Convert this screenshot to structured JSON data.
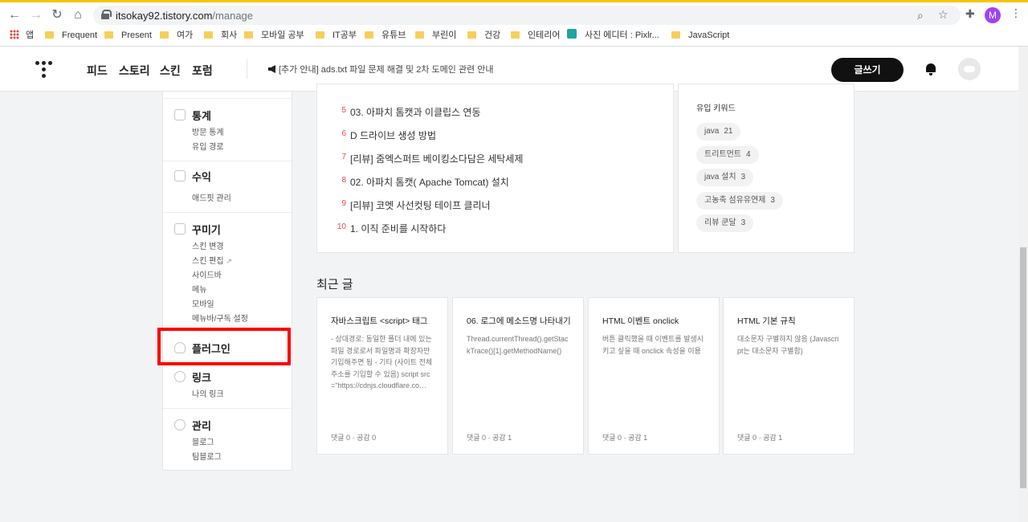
{
  "browser": {
    "url_host": "itsokay92.tistory.com",
    "url_path": "/manage",
    "profile_initial": "M",
    "bookmarks": [
      {
        "label": "앱",
        "icon": "apps-grid-icon"
      },
      {
        "label": "Frequent",
        "icon": "folder-icon"
      },
      {
        "label": "Present",
        "icon": "folder-icon"
      },
      {
        "label": "여가",
        "icon": "folder-icon"
      },
      {
        "label": "회사",
        "icon": "folder-icon"
      },
      {
        "label": "모바일 공부",
        "icon": "folder-icon"
      },
      {
        "label": "IT공부",
        "icon": "folder-icon"
      },
      {
        "label": "유튜브",
        "icon": "folder-icon"
      },
      {
        "label": "부린이",
        "icon": "folder-icon"
      },
      {
        "label": "건강",
        "icon": "folder-icon"
      },
      {
        "label": "인테리어",
        "icon": "folder-icon"
      },
      {
        "label": "사진 에디터 : Pixlr...",
        "icon": "pixlr-icon"
      },
      {
        "label": "JavaScript",
        "icon": "folder-icon"
      }
    ]
  },
  "header": {
    "nav": [
      "피드",
      "스토리",
      "스킨",
      "포럼"
    ],
    "notice": "[추가 안내] ads.txt 파일 문제 해결 및 2차 도메인 관련 안내",
    "write_label": "글쓰기"
  },
  "sidebar": {
    "groups": [
      {
        "title": "통계",
        "icon": "stats-icon",
        "items": [
          "방문 통계",
          "유입 경로"
        ]
      },
      {
        "title": "수익",
        "icon": "revenue-icon",
        "items": [
          "애드핏 관리"
        ]
      },
      {
        "title": "꾸미기",
        "icon": "customize-icon",
        "items": [
          "스킨 변경",
          "스킨 편집",
          "사이드바",
          "메뉴",
          "모바일",
          "메뉴바/구독 설정"
        ]
      },
      {
        "title": "플러그인",
        "icon": "plugin-icon",
        "items": []
      },
      {
        "title": "링크",
        "icon": "link-icon",
        "items": [
          "나의 링크"
        ]
      },
      {
        "title": "관리",
        "icon": "settings-icon",
        "items": [
          "블로그",
          "팀블로그"
        ]
      }
    ],
    "highlighted": "플러그인"
  },
  "popular_posts": [
    {
      "rank": "5",
      "title": "03. 아파치 톰캣과 이클립스 연동"
    },
    {
      "rank": "6",
      "title": "D 드라이브 생성 방법"
    },
    {
      "rank": "7",
      "title": "[리뷰] 줌엑스퍼트 베이킹소다담은 세탁세제"
    },
    {
      "rank": "8",
      "title": "02. 아파치 톰캣( Apache Tomcat) 설치"
    },
    {
      "rank": "9",
      "title": "[리뷰] 코멧 사선컷팅 테이프 클리너"
    },
    {
      "rank": "10",
      "title": "1. 이직 준비를 시작하다"
    }
  ],
  "keywords": {
    "title": "유입 키워드",
    "items": [
      {
        "label": "java",
        "count": "21"
      },
      {
        "label": "트리트먼트",
        "count": "4"
      },
      {
        "label": "java 설치",
        "count": "3"
      },
      {
        "label": "고농축 섬유유연제",
        "count": "3"
      },
      {
        "label": "리뷰 쿤달",
        "count": "3"
      }
    ]
  },
  "recent": {
    "title": "최근 글",
    "posts": [
      {
        "title": "자바스크립트 <script> 태그",
        "excerpt": "- 상대경로: 동일한 폴더 내에 있는 파일 경로로서 파일명과 확장자만 기입해주면 됨 - 기타 (사이트 전체 주소를 기입할 수 있음) script src =\"https://cdnjs.cloudflare.co…",
        "meta": "댓글 0 · 공감 0"
      },
      {
        "title": "06. 로그에 메소드명 나타내기",
        "excerpt": "Thread.currentThread().getStackTrace()[1].getMethodName()",
        "meta": "댓글 0 · 공감 1"
      },
      {
        "title": "HTML 이벤트 onclick",
        "excerpt": "버튼 클릭했을 때 이벤트를 발생시키고 싶을 때 onclick 속성을 이용",
        "meta": "댓글 0 · 공감 1"
      },
      {
        "title": "HTML 기본 규칙",
        "excerpt": "대소문자 구별하지 않음 (Javascript는 대소문자 구별함)",
        "meta": "댓글 0 · 공감 1"
      }
    ]
  }
}
